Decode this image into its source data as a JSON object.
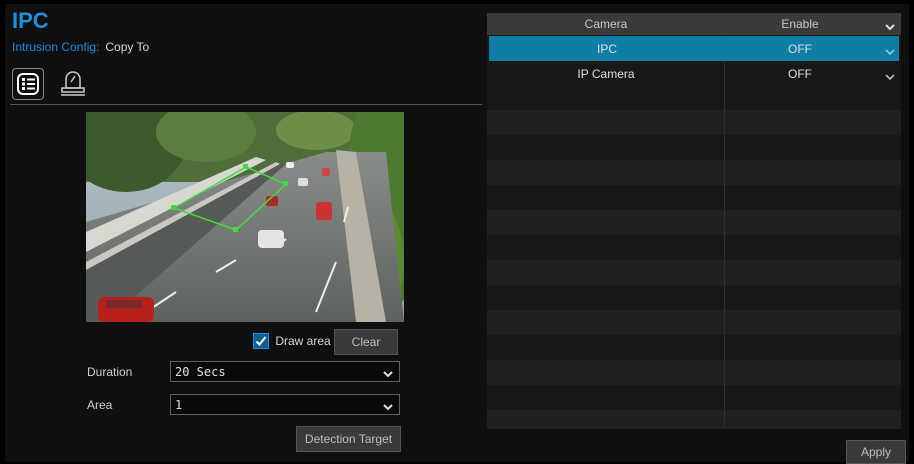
{
  "app": {
    "title": "IPC"
  },
  "subnav": {
    "active": "Intrusion Config:",
    "link": "Copy To"
  },
  "tabs": [
    {
      "icon": "list-settings-icon"
    },
    {
      "icon": "alarm-light-icon"
    }
  ],
  "controls": {
    "draw_area_label": "Draw area",
    "draw_area_checked": true,
    "clear_label": "Clear",
    "duration_label": "Duration",
    "duration_value": "20 Secs",
    "area_label": "Area",
    "area_value": "1",
    "detection_target_label": "Detection Target"
  },
  "table": {
    "headers": [
      "Camera",
      "Enable"
    ],
    "rows": [
      {
        "camera": "IPC",
        "enable": "OFF",
        "selected": true
      },
      {
        "camera": "IP Camera",
        "enable": "OFF",
        "selected": false
      }
    ]
  },
  "footer": {
    "apply_label": "Apply"
  },
  "colors": {
    "accent": "#1c8fe0",
    "selected_row": "#0e7ea6",
    "area_polygon": "#3fdc3f"
  }
}
